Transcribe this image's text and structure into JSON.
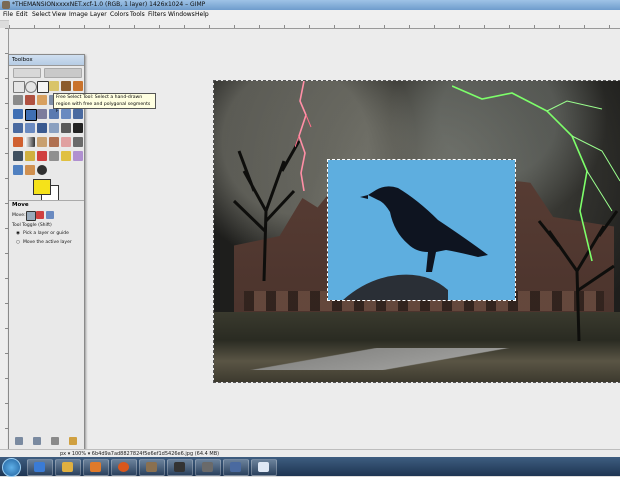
{
  "window": {
    "title": "*THEMANSIONxxxxNET.xcf-1.0 (RGB, 1 layer) 1426x1024 – GIMP"
  },
  "menu": [
    "File",
    "Edit",
    "Select",
    "View",
    "Image",
    "Layer",
    "Colors",
    "Tools",
    "Filters",
    "Windows",
    "Help"
  ],
  "toolbox": {
    "title": "Toolbox",
    "tooltip_line1": "Free Select Tool: Select a hand-drawn",
    "tooltip_line2": "region with free and polygonal segments  F",
    "fg_color": "#f5e21a",
    "bg_color": "#ffffff",
    "options_title": "Move",
    "move_label": "Move:",
    "toggle_label": "Tool Toggle  (Shift)",
    "option_pick": "Pick a layer or guide",
    "option_active": "Move the active layer"
  },
  "status": {
    "text": "px   ▾  100%  ▾  6b4d9a7ad8827824f5e6ef1d5426e6.jpg (64.4 MB)"
  },
  "taskbar": {
    "icons": [
      "start-orb",
      "explorer-icon",
      "folder-icon",
      "media-player-icon",
      "firefox-icon",
      "gimp-icon",
      "steam-icon",
      "app-icon",
      "app-icon-2",
      "snipping-tool-icon"
    ]
  }
}
